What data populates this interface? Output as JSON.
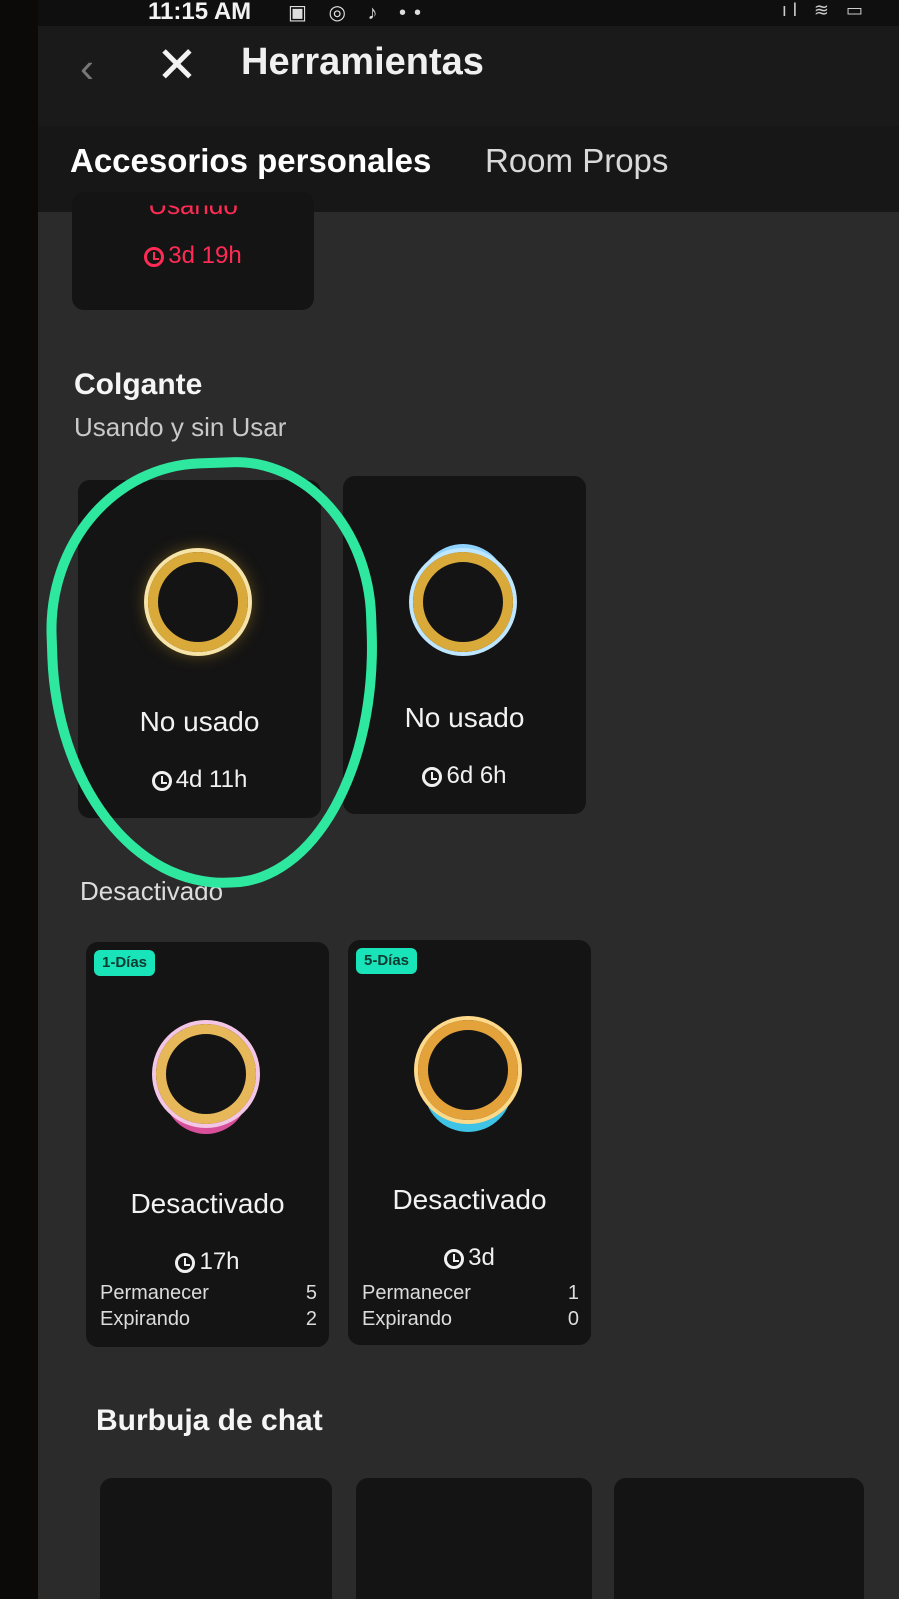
{
  "status_bar": {
    "time": "11:15 AM",
    "left_icons": "▣ ◎ ♪ ••",
    "right_icons": "ıl ≋ ▭"
  },
  "header": {
    "title": "Herramientas"
  },
  "tabs": {
    "active": "Accesorios personales",
    "inactive": "Room Props"
  },
  "top_card": {
    "status": "Usando",
    "time": "3d 19h",
    "color": "#ff2b55"
  },
  "colgante": {
    "title": "Colgante",
    "subtitle": "Usando y sin Usar",
    "items": [
      {
        "label": "No usado",
        "time": "4d 11h"
      },
      {
        "label": "No usado",
        "time": "6d 6h"
      }
    ]
  },
  "desactivado": {
    "title": "Desactivado",
    "items": [
      {
        "badge": "1-Días",
        "label": "Desactivado",
        "time": "17h",
        "remain_label": "Permanecer",
        "remain": "5",
        "expire_label": "Expirando",
        "expire": "2"
      },
      {
        "badge": "5-Días",
        "label": "Desactivado",
        "time": "3d",
        "remain_label": "Permanecer",
        "remain": "1",
        "expire_label": "Expirando",
        "expire": "0"
      }
    ]
  },
  "burbuja": {
    "title": "Burbuja de chat"
  },
  "accent_color": "#2ee8a0"
}
